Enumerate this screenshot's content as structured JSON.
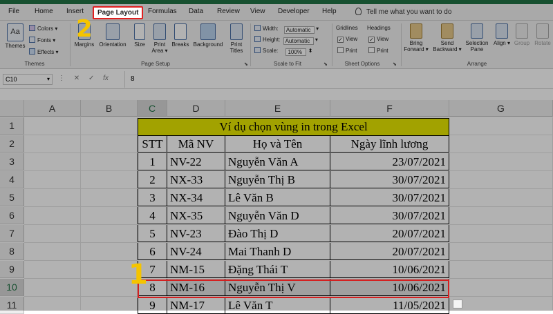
{
  "menu": {
    "tabs": [
      "File",
      "Home",
      "Insert",
      "Page Layout",
      "Formulas",
      "Data",
      "Review",
      "View",
      "Developer",
      "Help"
    ],
    "tell_me": "Tell me what you want to do"
  },
  "ribbon": {
    "themes": {
      "themes": "Themes",
      "colors": "Colors",
      "fonts": "Fonts",
      "effects": "Effects",
      "group": "Themes"
    },
    "page_setup": {
      "margins": "Margins",
      "orientation": "Orientation",
      "size": "Size",
      "print_area_1": "Print",
      "print_area_2": "Area",
      "breaks": "Breaks",
      "background": "Background",
      "print_titles_1": "Print",
      "print_titles_2": "Titles",
      "group": "Page Setup"
    },
    "scale_to_fit": {
      "width_label": "Width:",
      "width_value": "Automatic",
      "height_label": "Height:",
      "height_value": "Automatic",
      "scale_label": "Scale:",
      "scale_value": "100%",
      "group": "Scale to Fit"
    },
    "sheet_options": {
      "gridlines": "Gridlines",
      "headings": "Headings",
      "view": "View",
      "print": "Print",
      "group": "Sheet Options"
    },
    "arrange": {
      "bring_forward_1": "Bring",
      "bring_forward_2": "Forward",
      "send_backward_1": "Send",
      "send_backward_2": "Backward",
      "selection_pane_1": "Selection",
      "selection_pane_2": "Pane",
      "align": "Align",
      "group_btn": "Group",
      "rotate": "Rotate",
      "group": "Arrange"
    }
  },
  "formula_bar": {
    "name_box": "C10",
    "value": "8",
    "cancel": "✕",
    "enter": "✓",
    "fx": "fx"
  },
  "sheet": {
    "columns": [
      "A",
      "B",
      "C",
      "D",
      "E",
      "F",
      "G"
    ],
    "rows": [
      "1",
      "2",
      "3",
      "4",
      "5",
      "6",
      "7",
      "8",
      "9",
      "10",
      "11"
    ],
    "title": "Ví dụ chọn vùng in trong Excel",
    "headers": [
      "STT",
      "Mã NV",
      "Họ và Tên",
      "Ngày lĩnh lương"
    ],
    "data": [
      [
        "1",
        "NV-22",
        "Nguyễn Văn A",
        "23/07/2021"
      ],
      [
        "2",
        "NX-33",
        "Nguyễn Thị B",
        "30/07/2021"
      ],
      [
        "3",
        "NX-34",
        "Lê Văn B",
        "30/07/2021"
      ],
      [
        "4",
        "NX-35",
        "Nguyễn Văn D",
        "30/07/2021"
      ],
      [
        "5",
        "NV-23",
        "Đào Thị D",
        "20/07/2021"
      ],
      [
        "6",
        "NV-24",
        "Mai Thanh D",
        "20/07/2021"
      ],
      [
        "7",
        "NM-15",
        "Đặng Thái T",
        "10/06/2021"
      ],
      [
        "8",
        "NM-16",
        "Nguyễn Thị V",
        "10/06/2021"
      ],
      [
        "9",
        "NM-17",
        "Lê Văn T",
        "11/05/2021"
      ]
    ]
  },
  "annotations": {
    "step_1": "1",
    "step_2": "2"
  },
  "colors": {
    "accent": "#217346",
    "highlight": "#e8e800",
    "callout": "#f5c400",
    "selection_border": "#d42020"
  }
}
